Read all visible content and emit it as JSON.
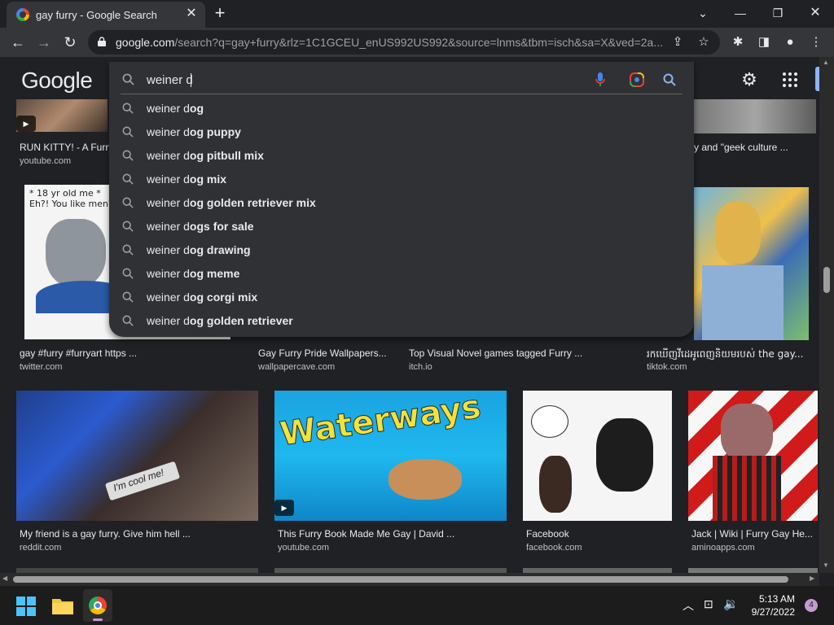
{
  "browser": {
    "tab_title": "gay furry - Google Search",
    "url_domain": "google.com",
    "url_path": "/search?q=gay+furry&rlz=1C1GCEU_enUS992US992&source=lnms&tbm=isch&sa=X&ved=2a...",
    "tab_close": "✕",
    "new_tab": "+"
  },
  "google": {
    "logo": "Google",
    "search_query": "weiner d",
    "suggestions": [
      {
        "prefix": "weiner d",
        "rest": "og"
      },
      {
        "prefix": "weiner d",
        "rest": "og puppy"
      },
      {
        "prefix": "weiner d",
        "rest": "og pitbull mix"
      },
      {
        "prefix": "weiner d",
        "rest": "og mix"
      },
      {
        "prefix": "weiner d",
        "rest": "og golden retriever mix"
      },
      {
        "prefix": "weiner d",
        "rest": "ogs for sale"
      },
      {
        "prefix": "weiner d",
        "rest": "og drawing"
      },
      {
        "prefix": "weiner d",
        "rest": "og meme"
      },
      {
        "prefix": "weiner d",
        "rest": "og corgi mix"
      },
      {
        "prefix": "weiner d",
        "rest": "og golden retriever"
      }
    ]
  },
  "results": {
    "row0": [
      {
        "caption": "RUN KITTY! - A Furry ...",
        "source": "youtube.com"
      },
      {
        "caption": "y and \"geek culture ...",
        "source": ""
      }
    ],
    "row1": [
      {
        "caption": "gay #furry #furryart https ...",
        "source": "twitter.com",
        "img_text": "* 18 yr old me *  Eh?! You like men?!"
      },
      {
        "caption": "Gay Furry Pride Wallpapers...",
        "source": "wallpapercave.com"
      },
      {
        "caption": "Top Visual Novel games tagged Furry ...",
        "source": "itch.io"
      },
      {
        "caption": "រកឃើញវីដេអូពេញនិយមរបស់ the gay...",
        "source": "tiktok.com"
      }
    ],
    "row2": [
      {
        "caption": "My friend is a gay furry. Give him hell ...",
        "source": "reddit.com",
        "img_text": "I'm cool me!"
      },
      {
        "caption": "This Furry Book Made Me Gay | David ...",
        "source": "youtube.com",
        "img_text": "Waterways"
      },
      {
        "caption": "Facebook",
        "source": "facebook.com"
      },
      {
        "caption": "Jack | Wiki | Furry Gay He...",
        "source": "aminoapps.com"
      }
    ]
  },
  "taskbar": {
    "time": "5:13 AM",
    "date": "9/27/2022",
    "notification_count": "4"
  },
  "colors": {
    "background": "#202124",
    "dropdown": "#303134",
    "toolbar": "#35363a"
  }
}
